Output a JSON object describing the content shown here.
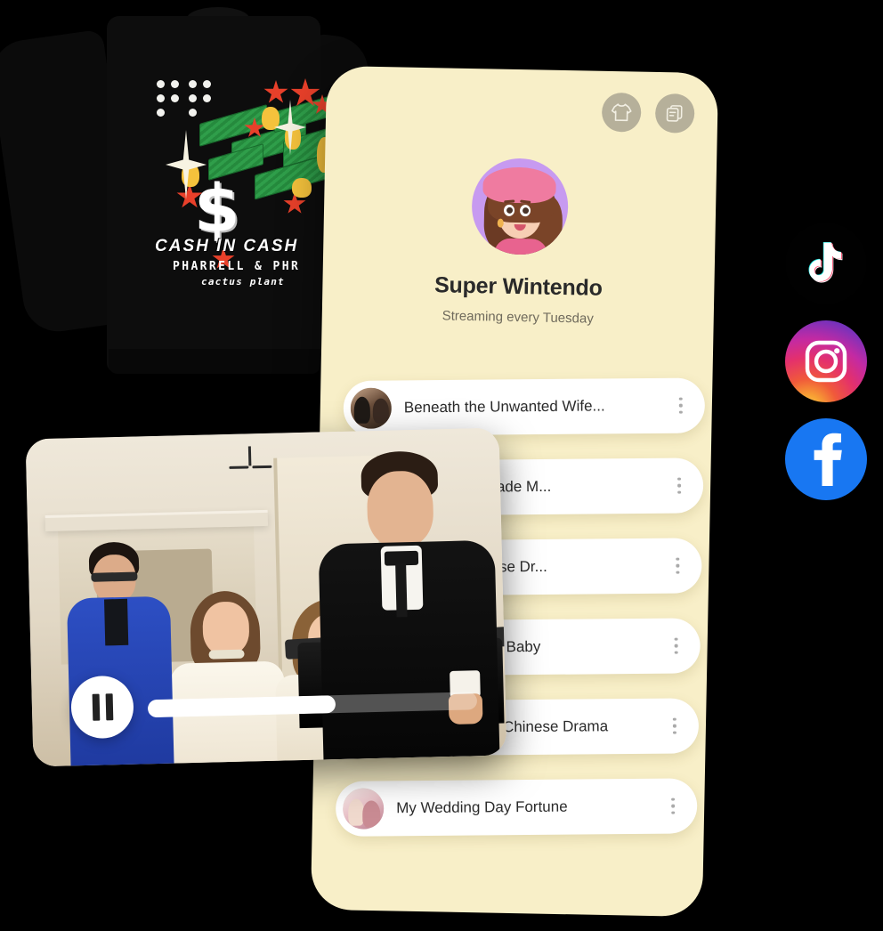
{
  "product": {
    "name": "sweatshirt-merch-photo",
    "print_lines": {
      "line1": "CASH IN CASH",
      "line2": "PHARRELL & PHR",
      "line3": "cactus plant"
    },
    "color": "#0d0d0d"
  },
  "phone": {
    "background": "#F8EFC8",
    "actions": [
      {
        "name": "merch-button",
        "icon": "tshirt-icon",
        "label": "Merch"
      },
      {
        "name": "episodes-button",
        "icon": "documents-icon",
        "label": "Episodes"
      }
    ],
    "profile": {
      "avatar": "cartoon-woman-avatar",
      "name": "Super Wintendo",
      "subtitle": "Streaming every Tuesday"
    },
    "list": [
      {
        "title": "Beneath the Unwanted Wife...",
        "thumb": "t1",
        "menu": "more-options"
      },
      {
        "title": "Best Friend Made M...",
        "thumb": "t2",
        "menu": "more-options"
      },
      {
        "title": "By Love Chinese Dr...",
        "thumb": "t3",
        "menu": "more-options"
      },
      {
        "title": "t Escort For My Baby",
        "thumb": "t4",
        "menu": "more-options"
      },
      {
        "title": "Invisible Wings Chinese Drama",
        "thumb": "t5",
        "menu": "more-options"
      },
      {
        "title": "My Wedding Day Fortune",
        "thumb": "t6",
        "menu": "more-options"
      }
    ]
  },
  "video": {
    "name": "video-player-card",
    "state": "playing",
    "play_button_icon": "pause-icon",
    "progress_percent": 57
  },
  "socials": [
    {
      "name": "tiktok",
      "label": "TikTok",
      "color": "#010101"
    },
    {
      "name": "instagram",
      "label": "Instagram",
      "color": "#E4306C"
    },
    {
      "name": "facebook",
      "label": "Facebook",
      "color": "#1877F2"
    }
  ],
  "colors": {
    "card_cream": "#F8EFC8",
    "row_white": "#FFFFFF",
    "text_dark": "#2B2B2B",
    "text_muted": "#6F6A5C",
    "action_btn": "#B6B09A",
    "background": "#000000"
  }
}
